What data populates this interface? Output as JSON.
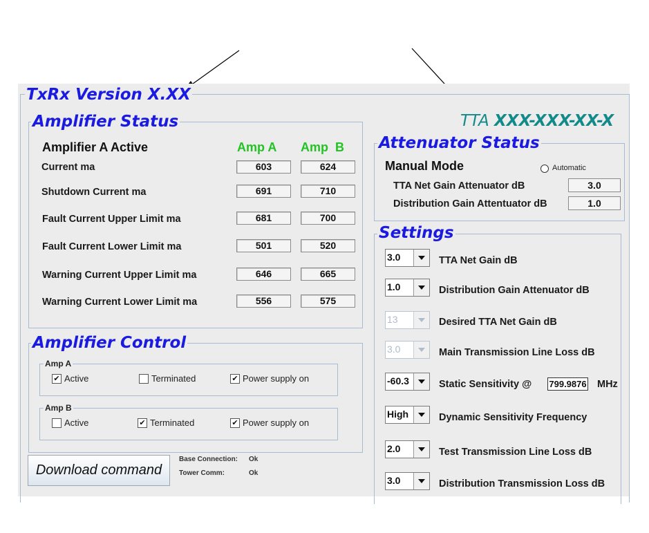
{
  "app": {
    "title": "TxRx Version X.XX",
    "model_prefix": "TTA",
    "model_number": "XXX-XXX-XX-X"
  },
  "amplifier_status": {
    "title": "Amplifier Status",
    "active_text": "Amplifier A Active",
    "amp_a_header": "Amp A",
    "amp_b_header": "Amp  B",
    "rows": [
      {
        "label": "Current ma",
        "a": "603",
        "b": "624"
      },
      {
        "label": "Shutdown Current ma",
        "a": "691",
        "b": "710"
      },
      {
        "label": "Fault Current Upper Limit ma",
        "a": "681",
        "b": "700"
      },
      {
        "label": "Fault Current Lower Limit ma",
        "a": "501",
        "b": "520"
      },
      {
        "label": "Warning Current Upper Limit ma",
        "a": "646",
        "b": "665"
      },
      {
        "label": "Warning Current Lower Limit ma",
        "a": "556",
        "b": "575"
      }
    ]
  },
  "amplifier_control": {
    "title": "Amplifier Control",
    "groups": [
      {
        "title": "Amp A",
        "active": {
          "label": "Active",
          "checked": "✔"
        },
        "terminated": {
          "label": "Terminated",
          "checked": ""
        },
        "power": {
          "label": "Power supply on",
          "checked": "✔"
        }
      },
      {
        "title": "Amp B",
        "active": {
          "label": "Active",
          "checked": ""
        },
        "terminated": {
          "label": "Terminated",
          "checked": "✔"
        },
        "power": {
          "label": "Power supply on",
          "checked": "✔"
        }
      }
    ]
  },
  "download_button": "Download command",
  "status_lines": [
    {
      "label": "Base Connection:",
      "value": "Ok"
    },
    {
      "label": "Tower Comm:",
      "value": "Ok"
    }
  ],
  "attenuator_status": {
    "title": "Attenuator Status",
    "mode": "Manual Mode",
    "automatic_label": "Automatic",
    "rows": [
      {
        "label": "TTA Net Gain Attenuator dB",
        "value": "3.0"
      },
      {
        "label": "Distribution Gain Attentuator dB",
        "value": "1.0"
      }
    ]
  },
  "settings": {
    "title": "Settings",
    "items": [
      {
        "value": "3.0",
        "label": "TTA Net Gain dB"
      },
      {
        "value": "1.0",
        "label": "Distribution Gain Attenuator dB"
      },
      {
        "value": "13",
        "label": "Desired TTA Net Gain dB"
      },
      {
        "value": "3.0",
        "label": "Main Transmission Line Loss dB"
      },
      {
        "value": "-60.3",
        "label": "Static Sensitivity @",
        "freq": "799.9876",
        "unit": "MHz"
      },
      {
        "value": "High",
        "label": "Dynamic Sensitivity Frequency"
      },
      {
        "value": "2.0",
        "label": "Test Transmission Line Loss dB"
      },
      {
        "value": "3.0",
        "label": "Distribution Transmission Loss dB"
      }
    ]
  },
  "colors": {
    "title_blue": "#1a1ae0",
    "amp_green": "#22c322",
    "model_teal": "#138a8a",
    "panel_bg": "#ececec",
    "frame_border": "#a7bcd2"
  }
}
